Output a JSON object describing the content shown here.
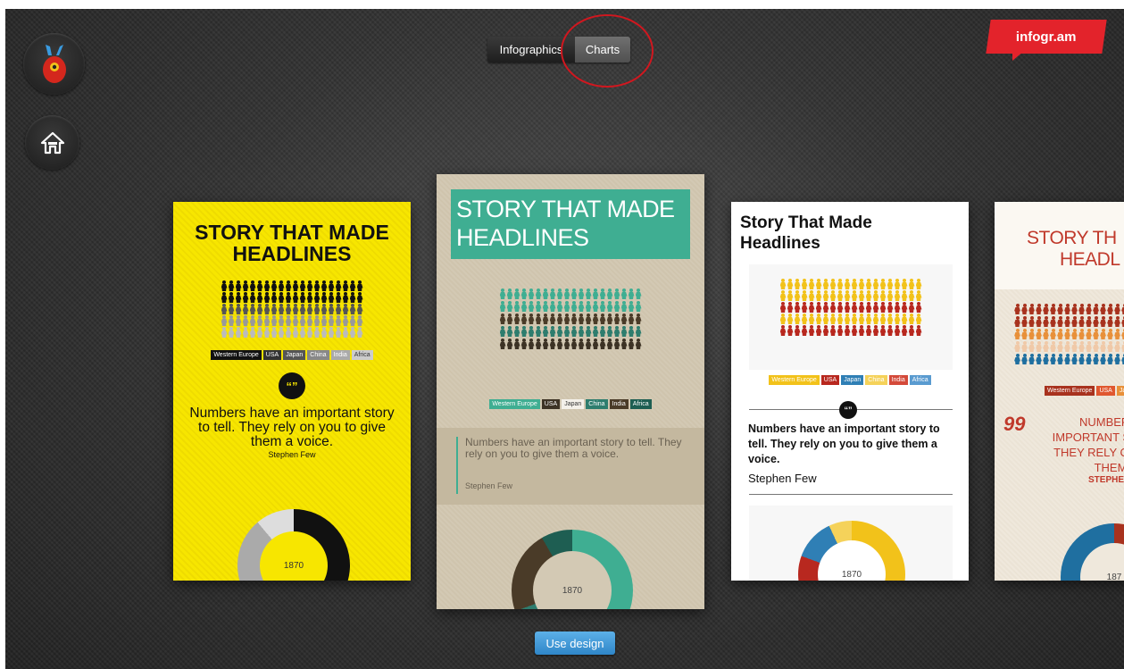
{
  "header": {
    "tabs": [
      {
        "label": "Infographics"
      },
      {
        "label": "Charts"
      }
    ],
    "brand": "infogr.am"
  },
  "cards": [
    {
      "title_line1": "STORY THAT MADE",
      "title_line2": "HEADLINES",
      "legend": [
        "Western Europe",
        "USA",
        "Japan",
        "China",
        "India",
        "Africa"
      ],
      "quote_mark": "“”",
      "quote": "Numbers have an important story to tell. They rely on you to give them a voice.",
      "author": "Stephen Few",
      "donut_label": "1870"
    },
    {
      "title_line1": "STORY THAT MADE",
      "title_line2": "HEADLINES",
      "legend": [
        "Western Europe",
        "USA",
        "Japan",
        "China",
        "India",
        "Africa"
      ],
      "quote": "Numbers have an important story to tell. They rely on you to give them a voice.",
      "author": "Stephen Few",
      "donut_label": "1870"
    },
    {
      "title_line1": "Story That Made",
      "title_line2": "Headlines",
      "legend": [
        "Western Europe",
        "USA",
        "Japan",
        "China",
        "India",
        "Africa"
      ],
      "quote_mark": "“”",
      "quote": "Numbers have an important story to tell. They rely on you to give them a voice.",
      "author": "Stephen Few",
      "donut_label": "1870"
    },
    {
      "title_line1": "STORY TH",
      "title_line2": "HEADL",
      "legend": [
        "Western Europe",
        "USA",
        "Japa"
      ],
      "quote_mark": "99",
      "quote_lines": [
        "NUMBERS",
        "IMPORTANT ST",
        "THEY RELY ON",
        "THEM A"
      ],
      "author": "STEPHE",
      "donut_label": "187"
    }
  ],
  "footer": {
    "use_design": "Use design"
  },
  "colors": {
    "accent_red": "#e3232b",
    "button_blue": "#2f86c8",
    "card1_bg": "#f7e600",
    "card2_teal": "#3fae92"
  }
}
